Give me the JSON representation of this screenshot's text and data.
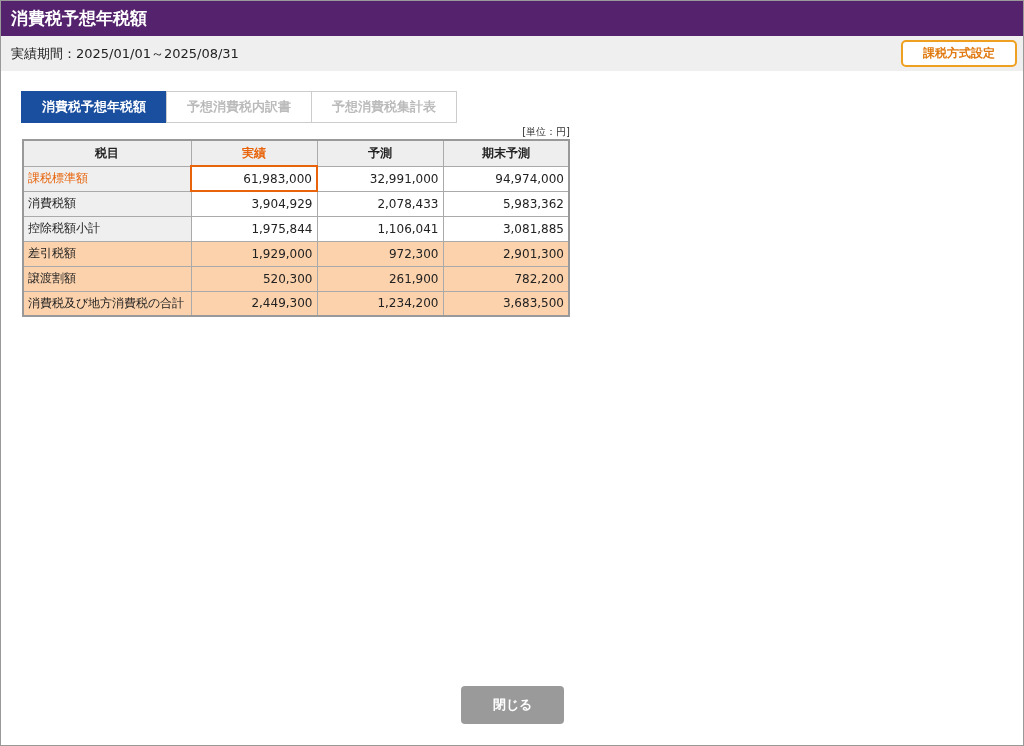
{
  "window": {
    "title": "消費税予想年税額"
  },
  "period": {
    "label": "実績期間：2025/01/01～2025/08/31"
  },
  "settings_button": {
    "label": "課税方式設定"
  },
  "tabs": [
    {
      "label": "消費税予想年税額",
      "selected": true
    },
    {
      "label": "予想消費税内訳書",
      "selected": false
    },
    {
      "label": "予想消費税集計表",
      "selected": false
    }
  ],
  "unit": "[単位：円]",
  "table": {
    "columns": [
      {
        "label": "税目",
        "selected": false
      },
      {
        "label": "実績",
        "selected": true
      },
      {
        "label": "予測",
        "selected": false
      },
      {
        "label": "期末予測",
        "selected": false
      }
    ],
    "rows": [
      {
        "cells": [
          "課税標準額",
          "61,983,000",
          "32,991,000",
          "94,974,000"
        ],
        "selected": true,
        "highlighted": false
      },
      {
        "cells": [
          "消費税額",
          "3,904,929",
          "2,078,433",
          "5,983,362"
        ],
        "selected": false,
        "highlighted": false
      },
      {
        "cells": [
          "控除税額小計",
          "1,975,844",
          "1,106,041",
          "3,081,885"
        ],
        "selected": false,
        "highlighted": false
      },
      {
        "cells": [
          "差引税額",
          "1,929,000",
          "972,300",
          "2,901,300"
        ],
        "selected": false,
        "highlighted": true
      },
      {
        "cells": [
          "譲渡割額",
          "520,300",
          "261,900",
          "782,200"
        ],
        "selected": false,
        "highlighted": true
      },
      {
        "cells": [
          "消費税及び地方消費税の合計",
          "2,449,300",
          "1,234,200",
          "3,683,500"
        ],
        "selected": false,
        "highlighted": true
      }
    ]
  },
  "close_button": {
    "label": "閉じる",
    "disabled": true
  }
}
